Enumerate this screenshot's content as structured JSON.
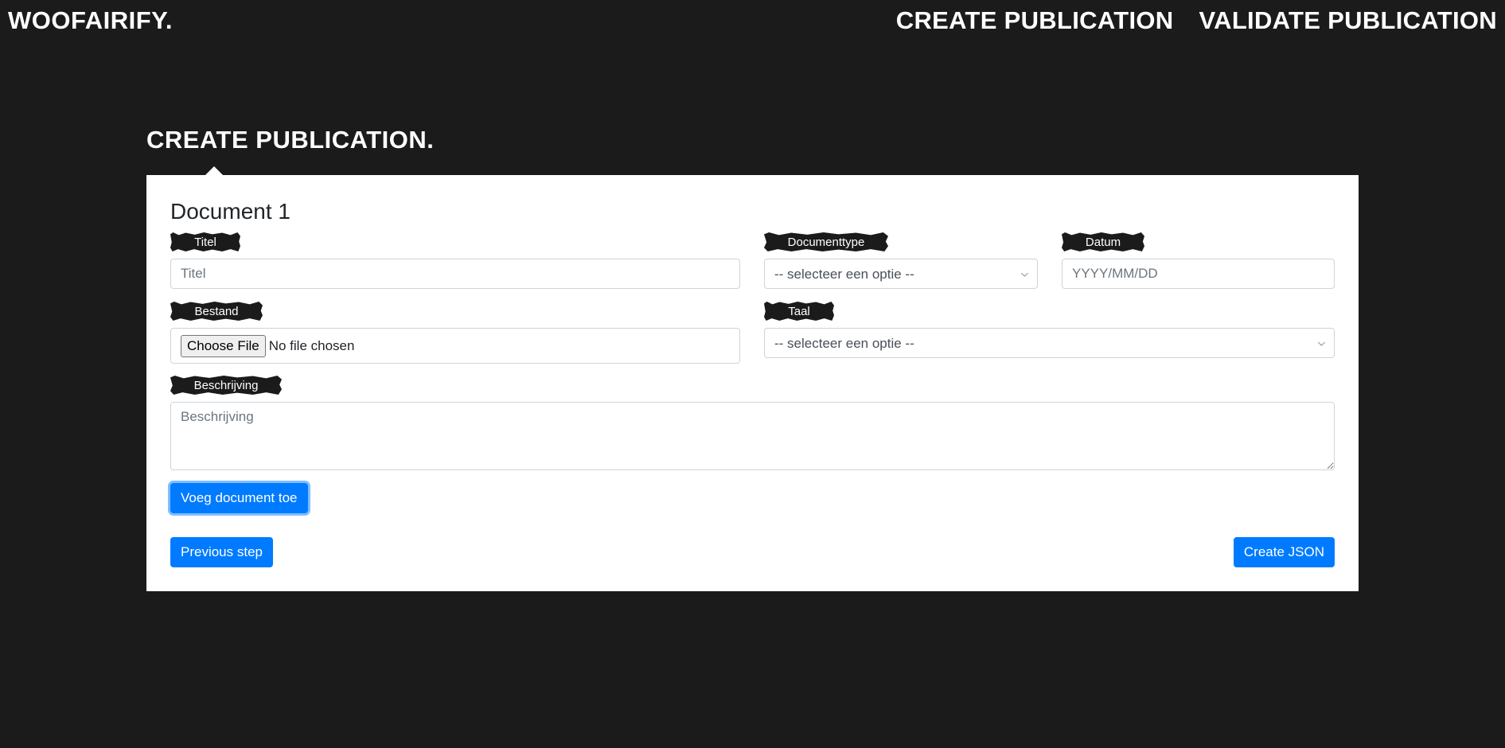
{
  "header": {
    "brand": "WOOFAIRIFY.",
    "nav": [
      "CREATE PUBLICATION",
      "VALIDATE PUBLICATION"
    ]
  },
  "page": {
    "title": "CREATE PUBLICATION."
  },
  "form": {
    "document_heading": "Document 1",
    "titel": {
      "label": "Titel",
      "placeholder": "Titel",
      "value": ""
    },
    "documenttype": {
      "label": "Documenttype",
      "selected": "-- selecteer een optie --"
    },
    "datum": {
      "label": "Datum",
      "placeholder": "YYYY/MM/DD",
      "value": ""
    },
    "bestand": {
      "label": "Bestand",
      "button": "Choose File",
      "status": "No file chosen"
    },
    "taal": {
      "label": "Taal",
      "selected": "-- selecteer een optie --"
    },
    "beschrijving": {
      "label": "Beschrijving",
      "placeholder": "Beschrijving",
      "value": ""
    },
    "add_document_button": "Voeg document toe",
    "previous_button": "Previous step",
    "create_json_button": "Create JSON"
  },
  "colors": {
    "background": "#1b1b1b",
    "card": "#ffffff",
    "primary": "#007bff"
  },
  "icons": {
    "select_arrow": "chevron-down-icon"
  }
}
